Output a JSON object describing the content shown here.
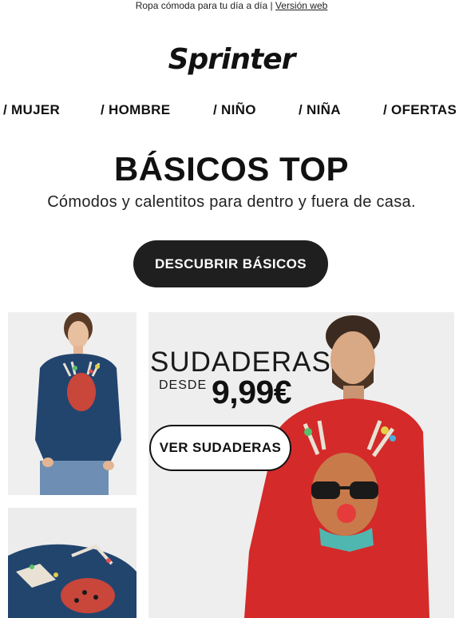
{
  "preheader": {
    "text": "Ropa cómoda para tu día a día | ",
    "link": "Versión web"
  },
  "logo": {
    "text": "Sprinter"
  },
  "nav": [
    {
      "label": "/ MUJER"
    },
    {
      "label": "/ HOMBRE"
    },
    {
      "label": "/ NIÑO"
    },
    {
      "label": "/ NIÑA"
    },
    {
      "label": "/ OFERTAS"
    }
  ],
  "hero": {
    "title": "BÁSICOS TOP",
    "subtitle": "Cómodos y calentitos para dentro y fuera de casa.",
    "cta": "DESCUBRIR BÁSICOS"
  },
  "promo": {
    "heading": "SUDADERAS",
    "from_label": "DESDE",
    "price": "9,99€",
    "cta": "VER SUDADERAS"
  },
  "colors": {
    "navy_sweater": "#22456e",
    "red_sweater": "#d42a2a",
    "dark_button": "#1f1f1f"
  }
}
